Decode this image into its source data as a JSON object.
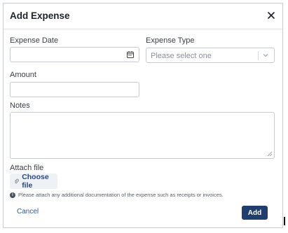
{
  "dialog": {
    "title": "Add Expense",
    "close_icon": "close-icon"
  },
  "form": {
    "expense_date": {
      "label": "Expense Date",
      "value": "",
      "icon": "calendar-icon"
    },
    "expense_type": {
      "label": "Expense Type",
      "placeholder": "Please select one",
      "icon": "chevron-down-icon"
    },
    "amount": {
      "label": "Amount",
      "value": ""
    },
    "notes": {
      "label": "Notes",
      "value": ""
    },
    "attach": {
      "label": "Attach file",
      "button_label": "Choose file",
      "button_icon": "paperclip-icon",
      "hint": "Please attach any additional documentation of the expense such as receipts or invoices.",
      "hint_icon": "info-icon"
    }
  },
  "footer": {
    "cancel_label": "Cancel",
    "add_label": "Add"
  },
  "colors": {
    "primary": "#1e3f6e",
    "link": "#2c5aa0",
    "border": "#c8ccd2"
  }
}
